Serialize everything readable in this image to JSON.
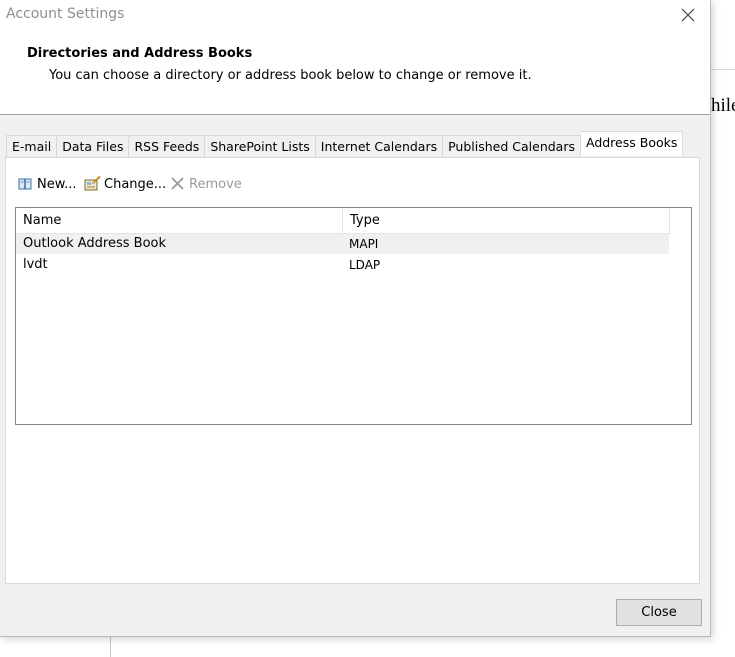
{
  "background": {
    "partial_text": "hile"
  },
  "dialog": {
    "title": "Account Settings",
    "header": {
      "title": "Directories and Address Books",
      "description": "You can choose a directory or address book below to change or remove it."
    },
    "tabs": [
      {
        "label": "E-mail",
        "active": false
      },
      {
        "label": "Data Files",
        "active": false
      },
      {
        "label": "RSS Feeds",
        "active": false
      },
      {
        "label": "SharePoint Lists",
        "active": false
      },
      {
        "label": "Internet Calendars",
        "active": false
      },
      {
        "label": "Published Calendars",
        "active": false
      },
      {
        "label": "Address Books",
        "active": true
      }
    ],
    "toolbar": {
      "new_label": "New...",
      "change_label": "Change...",
      "remove_label": "Remove",
      "remove_disabled": true
    },
    "list": {
      "columns": [
        "Name",
        "Type"
      ],
      "rows": [
        {
          "name": "Outlook Address Book",
          "type": "MAPI",
          "selected": true
        },
        {
          "name": "lvdt",
          "type": "LDAP",
          "selected": false
        }
      ]
    },
    "footer": {
      "close_label": "Close"
    }
  },
  "icons": {
    "close": "close-icon",
    "new": "address-book-icon",
    "change": "address-book-edit-icon",
    "remove": "x-icon"
  },
  "colors": {
    "dialog_bg": "#f0f0f0",
    "panel_bg": "#ffffff",
    "selected_row": "#f0f0f0",
    "disabled_text": "#9a9a9a",
    "title_text": "#8f8f8f"
  }
}
